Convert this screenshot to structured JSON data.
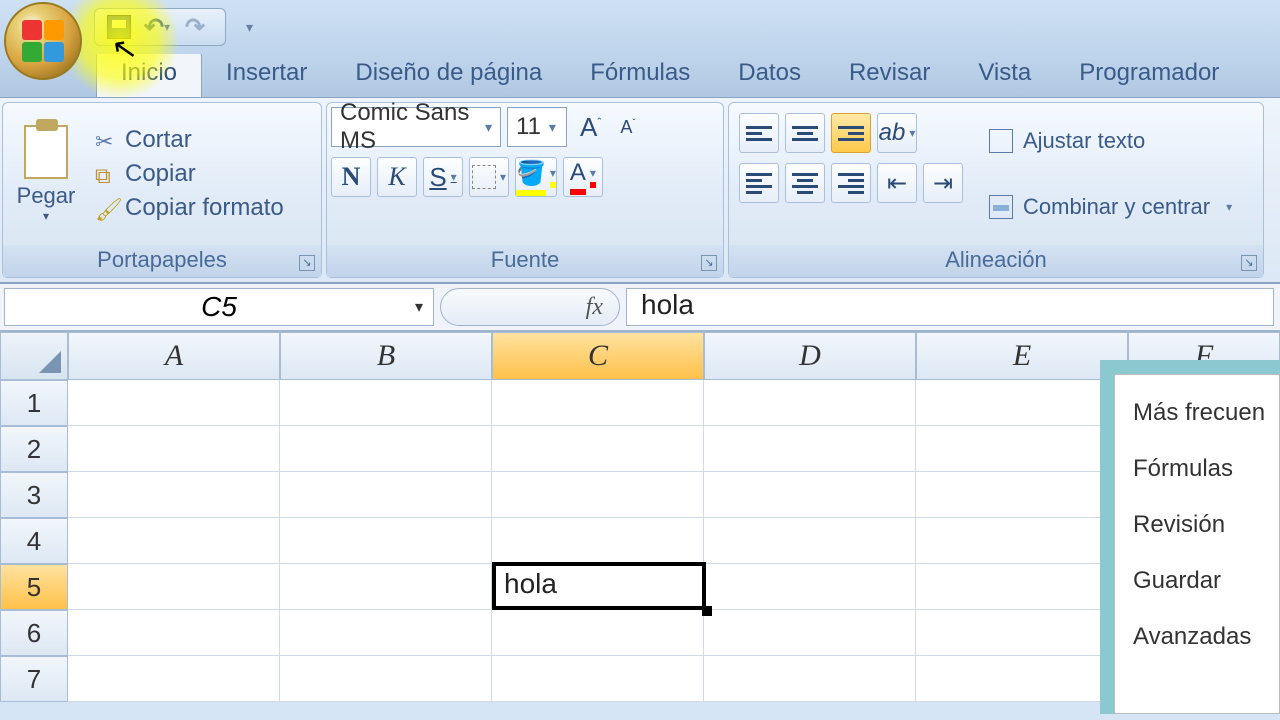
{
  "qat": {
    "customize_tip": "▾"
  },
  "tabs": {
    "inicio": "Inicio",
    "insertar": "Insertar",
    "diseno": "Diseño de página",
    "formulas": "Fórmulas",
    "datos": "Datos",
    "revisar": "Revisar",
    "vista": "Vista",
    "programador": "Programador"
  },
  "clipboard": {
    "pegar": "Pegar",
    "cortar": "Cortar",
    "copiar": "Copiar",
    "copiar_formato": "Copiar formato",
    "group_label": "Portapapeles"
  },
  "font": {
    "name": "Comic Sans MS",
    "size": "11",
    "bold": "N",
    "italic": "K",
    "underline": "S",
    "bigA": "A",
    "smallA": "A",
    "fontcolor": "A",
    "group_label": "Fuente"
  },
  "align": {
    "wrap": "Ajustar texto",
    "merge": "Combinar y centrar",
    "group_label": "Alineación"
  },
  "formula_bar": {
    "name_box": "C5",
    "fx": "fx",
    "value": "hola"
  },
  "columns": [
    "A",
    "B",
    "C",
    "D",
    "E",
    "F"
  ],
  "rows": [
    "1",
    "2",
    "3",
    "4",
    "5",
    "6",
    "7"
  ],
  "selected_cell": {
    "ref": "C5",
    "value": "hola"
  },
  "options_panel": {
    "items": [
      "Más frecuen",
      "Fórmulas",
      "Revisión",
      "Guardar",
      "Avanzadas"
    ]
  }
}
